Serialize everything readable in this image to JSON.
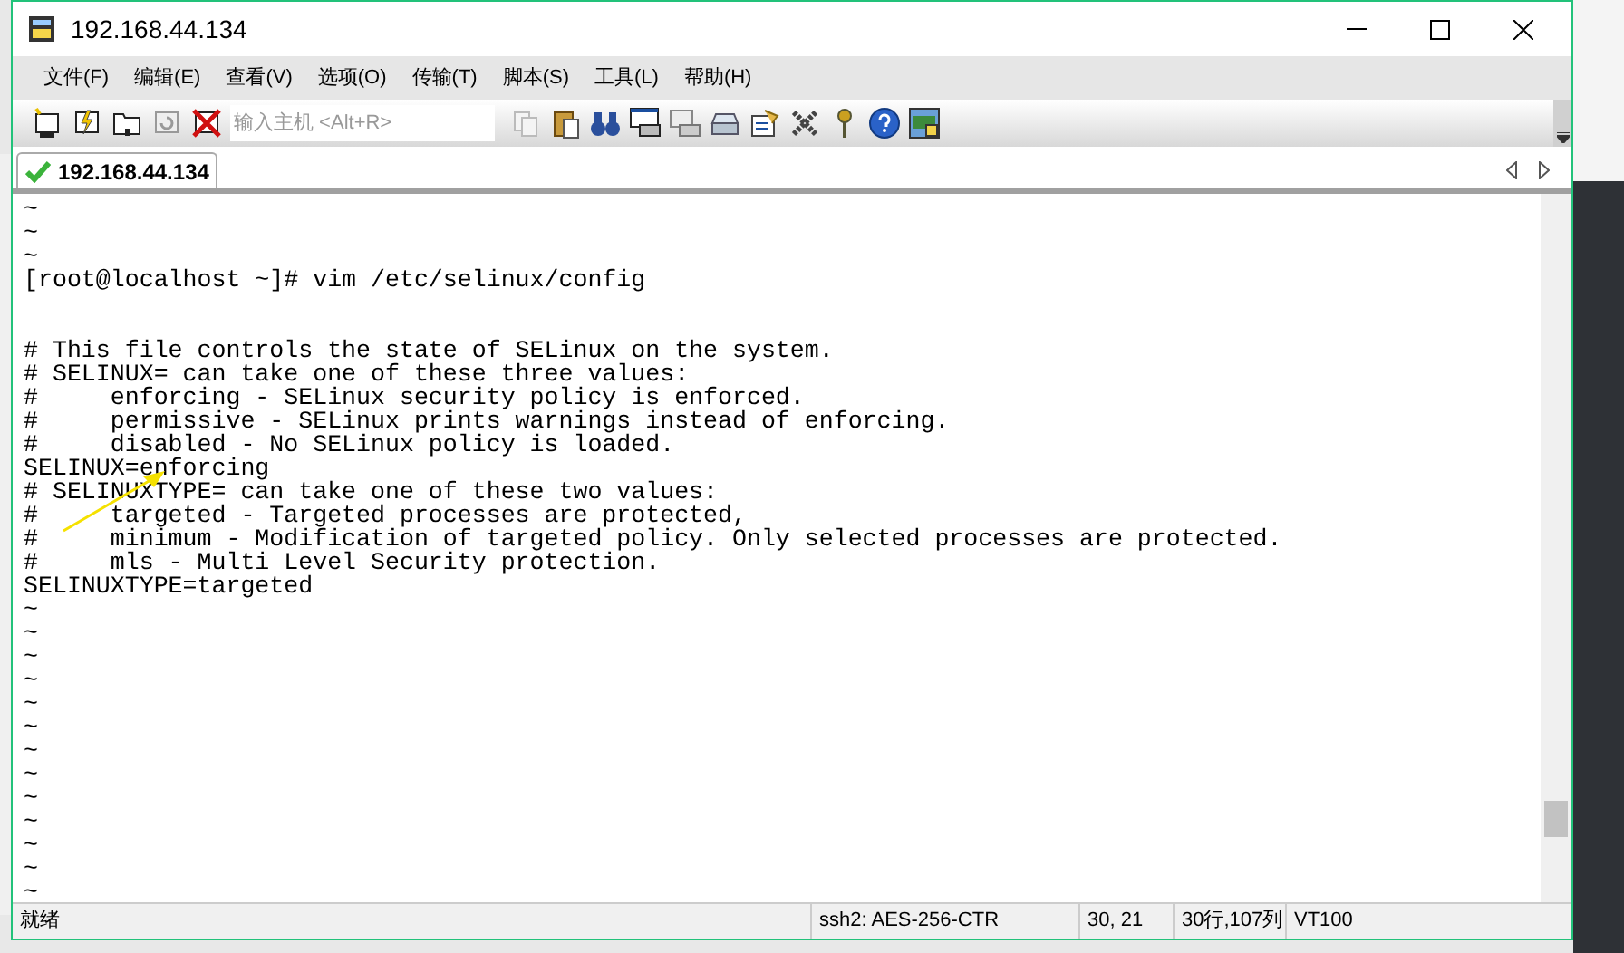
{
  "window": {
    "title": "192.168.44.134"
  },
  "menu": [
    "文件(F)",
    "编辑(E)",
    "查看(V)",
    "选项(O)",
    "传输(T)",
    "脚本(S)",
    "工具(L)",
    "帮助(H)"
  ],
  "host_field": {
    "placeholder": "输入主机 <Alt+R>"
  },
  "tabs": [
    {
      "label": "192.168.44.134",
      "selected": true,
      "connected": true
    }
  ],
  "terminal": {
    "lines": [
      {
        "kind": "text",
        "text": "~"
      },
      {
        "kind": "text",
        "text": "~"
      },
      {
        "kind": "text",
        "text": "~"
      },
      {
        "kind": "text",
        "text": "[root@localhost ~]# vim /etc/selinux/config"
      },
      {
        "kind": "blank"
      },
      {
        "kind": "blank"
      },
      {
        "kind": "text",
        "text": "# This file controls the state of SELinux on the system."
      },
      {
        "kind": "text",
        "text": "# SELINUX= can take one of these three values:"
      },
      {
        "kind": "text",
        "text": "#     enforcing - SELinux security policy is enforced."
      },
      {
        "kind": "text",
        "text": "#     permissive - SELinux prints warnings instead of enforcing."
      },
      {
        "kind": "text",
        "text": "#     disabled - No SELinux policy is loaded."
      },
      {
        "kind": "text",
        "text": "SELINUX=enforcing"
      },
      {
        "kind": "text",
        "text": "# SELINUXTYPE= can take one of these two values:"
      },
      {
        "kind": "text",
        "text": "#     targeted - Targeted processes are protected,"
      },
      {
        "kind": "text",
        "text": "#     minimum - Modification of targeted policy. Only selected processes are protected."
      },
      {
        "kind": "text",
        "text": "#     mls - Multi Level Security protection."
      },
      {
        "kind": "text",
        "text": "SELINUXTYPE=targeted"
      },
      {
        "kind": "text",
        "text": "~"
      },
      {
        "kind": "text",
        "text": "~"
      },
      {
        "kind": "text",
        "text": "~"
      },
      {
        "kind": "text",
        "text": "~"
      },
      {
        "kind": "text",
        "text": "~"
      },
      {
        "kind": "text",
        "text": "~"
      },
      {
        "kind": "text",
        "text": "~"
      },
      {
        "kind": "text",
        "text": "~"
      },
      {
        "kind": "text",
        "text": "~"
      },
      {
        "kind": "text",
        "text": "~"
      },
      {
        "kind": "text",
        "text": "~"
      },
      {
        "kind": "text",
        "text": "~"
      },
      {
        "kind": "text",
        "text": "~"
      }
    ]
  },
  "status_bar": [
    "就绪",
    "ssh2: AES-256-CTR",
    "30,  21",
    "30行,107列",
    "VT100"
  ]
}
